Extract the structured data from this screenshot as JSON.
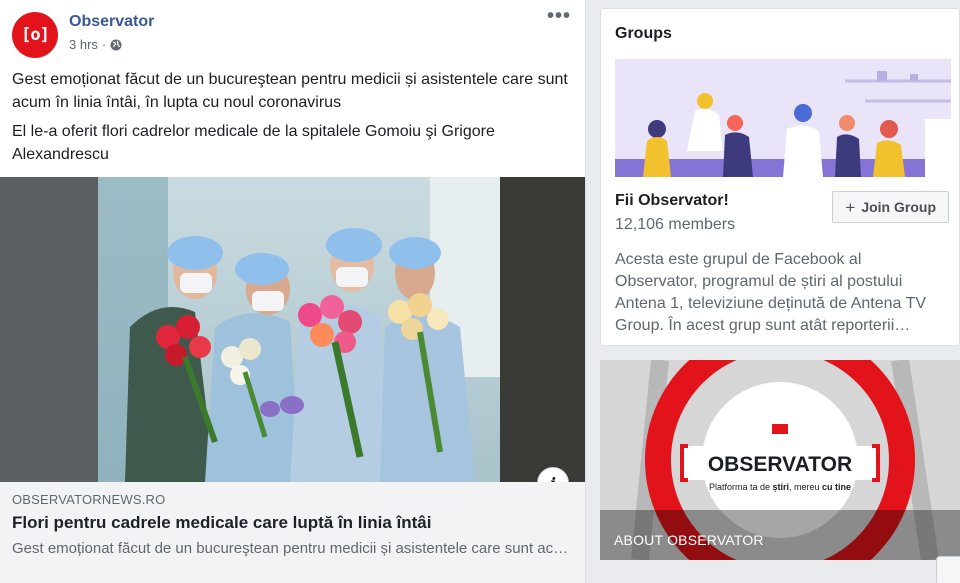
{
  "post": {
    "page_name": "Observator",
    "avatar_glyph": "[o]",
    "time": "3 hrs",
    "separator": "·",
    "privacy_icon": "globe-icon",
    "more_icon": "ellipsis-icon",
    "text_line1": "Gest emoționat făcut de un bucureştean pentru medicii și asistentele care sunt acum în linia întâi, în lupta cu noul coronavirus",
    "text_line2": "El le-a oferit flori cadrelor medicale de la spitalele Gomoiu şi Grigore Alexandrescu",
    "info_icon": "i",
    "link": {
      "domain": "OBSERVATORNEWS.RO",
      "title": "Flori pentru cadrele medicale care luptă în linia întâi",
      "description": "Gest emoționat făcut de un bucureştean pentru medicii și asistentele care sunt acum în linia întâi, în lupta cu noul coronavirus"
    }
  },
  "groups": {
    "heading": "Groups",
    "name": "Fii Observator!",
    "members": "12,106 members",
    "join_label": "Join Group",
    "description": "Acesta este grupul de Facebook al Observator, programul de știri al postului Antena 1, televiziune deținută de Antena TV Group. În acest grup sunt atât reporterii…"
  },
  "about": {
    "logo_text": "OBSERVATOR",
    "tagline_prefix": "Platforma ta de ",
    "tagline_bold1": "știri",
    "tagline_middle": ", mereu ",
    "tagline_bold2": "cu tine",
    "label": "ABOUT OBSERVATOR"
  },
  "colors": {
    "brand_red": "#e2131a",
    "link_blue": "#385898"
  }
}
